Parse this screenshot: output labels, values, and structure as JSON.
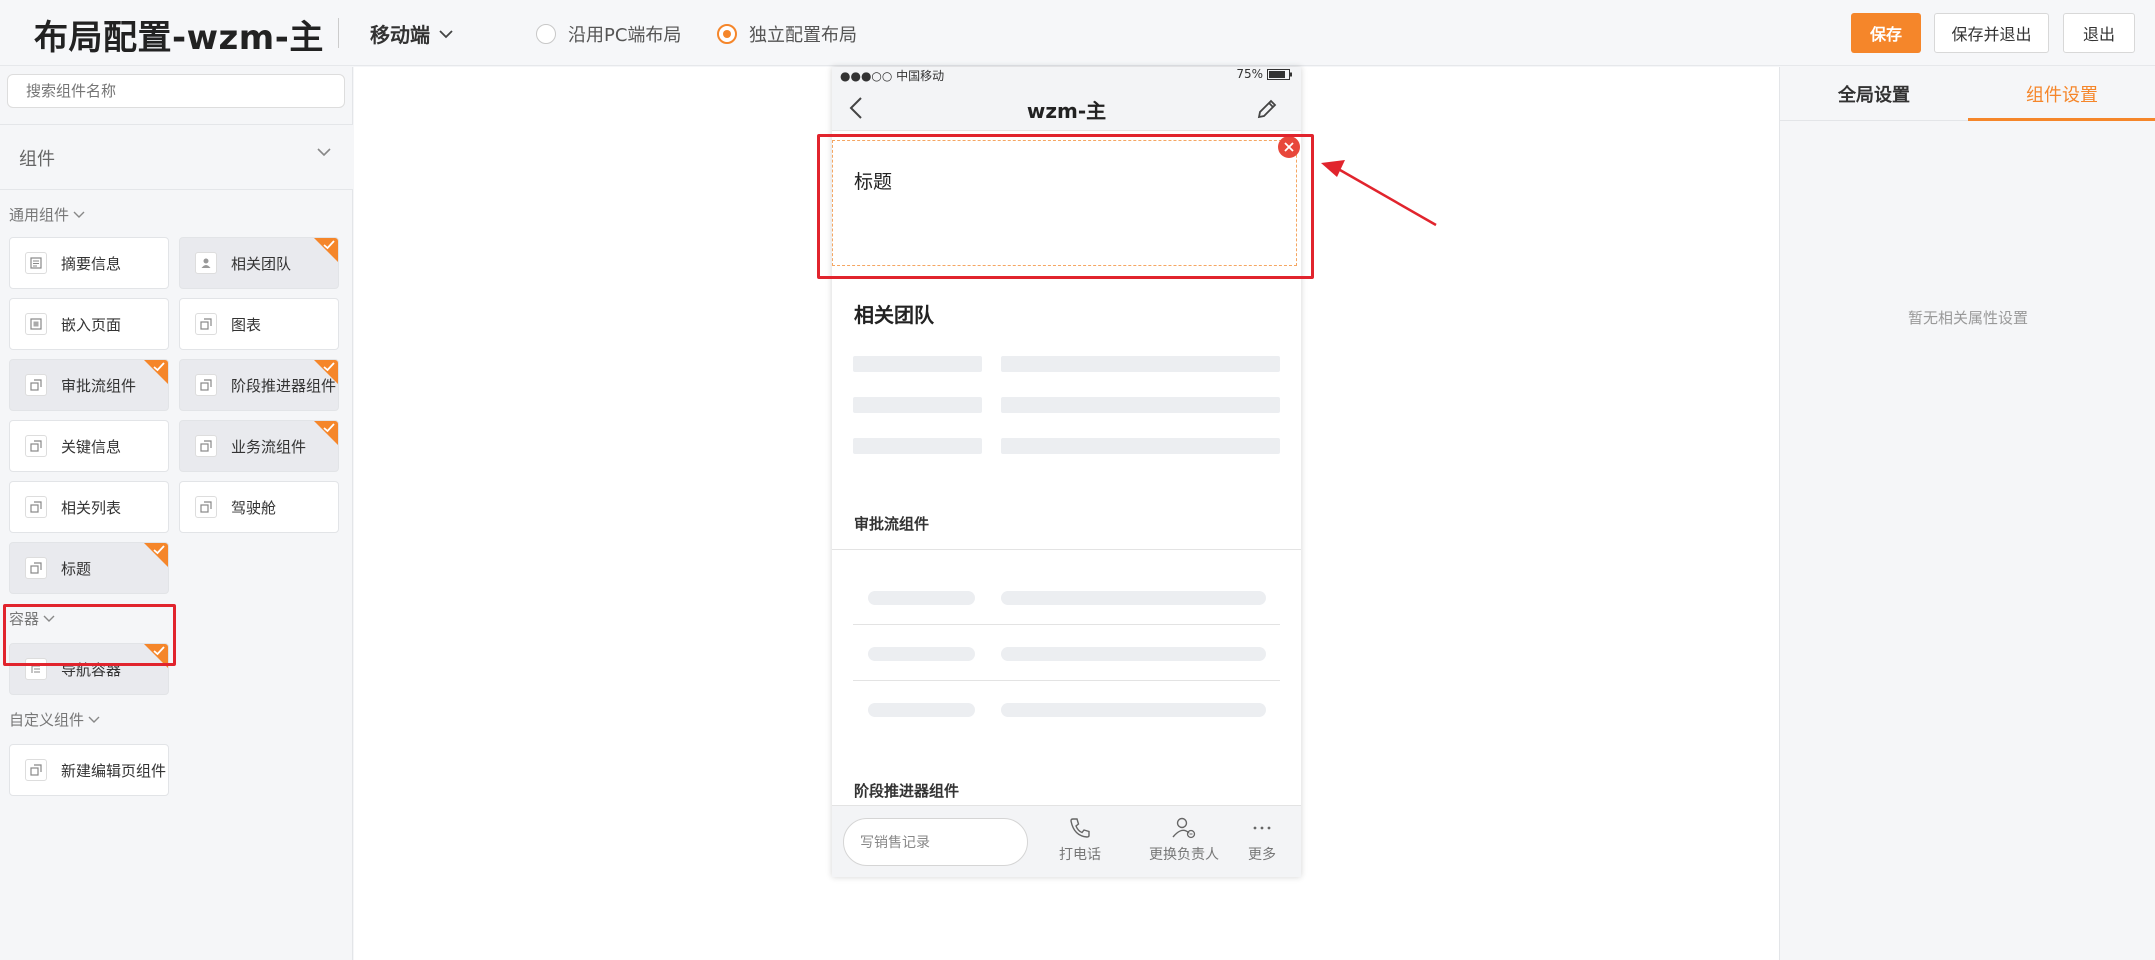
{
  "header": {
    "title": "布局配置-wzm-主",
    "device": "移动端",
    "layout_options": [
      "沿用PC端布局",
      "独立配置布局"
    ],
    "selected_layout": "独立配置布局",
    "save_label": "保存",
    "save_exit_label": "保存并退出",
    "exit_label": "退出"
  },
  "sidebar": {
    "search_placeholder": "搜索组件名称",
    "components_header": "组件",
    "common_label": "通用组件",
    "common_items": [
      {
        "label": "摘要信息",
        "icon": "summary-icon",
        "used": false
      },
      {
        "label": "相关团队",
        "icon": "person-icon",
        "used": true
      },
      {
        "label": "嵌入页面",
        "icon": "embed-icon",
        "used": false
      },
      {
        "label": "图表",
        "icon": "component-icon",
        "used": false
      },
      {
        "label": "审批流组件",
        "icon": "component-icon",
        "used": true
      },
      {
        "label": "阶段推进器组件",
        "icon": "component-icon",
        "used": true
      },
      {
        "label": "关键信息",
        "icon": "component-icon",
        "used": false
      },
      {
        "label": "业务流组件",
        "icon": "component-icon",
        "used": true
      },
      {
        "label": "相关列表",
        "icon": "component-icon",
        "used": false
      },
      {
        "label": "驾驶舱",
        "icon": "component-icon",
        "used": false
      },
      {
        "label": "标题",
        "icon": "component-icon",
        "used": true
      }
    ],
    "container_label": "容器",
    "container_items": [
      {
        "label": "导航容器",
        "icon": "tree-icon",
        "used": true
      }
    ],
    "custom_label": "自定义组件",
    "custom_items": [
      {
        "label": "新建编辑页组件",
        "icon": "component-icon",
        "used": false
      }
    ]
  },
  "phone": {
    "carrier": "●●●○○ 中国移动",
    "battery": "75%",
    "nav_title": "wzm-主",
    "selected_title": "标题",
    "team_title": "相关团队",
    "approval_title": "审批流组件",
    "stage_title": "阶段推进器组件",
    "toolbar": {
      "input_placeholder": "写销售记录",
      "call_label": "打电话",
      "change_owner_label": "更换负责人",
      "more_label": "更多"
    }
  },
  "right_panel": {
    "tab_global": "全局设置",
    "tab_component": "组件设置",
    "active_tab": "组件设置",
    "empty_message": "暂无相关属性设置"
  },
  "colors": {
    "accent": "#f5862a",
    "highlight": "#e1242d",
    "close_button": "#e8473b"
  }
}
